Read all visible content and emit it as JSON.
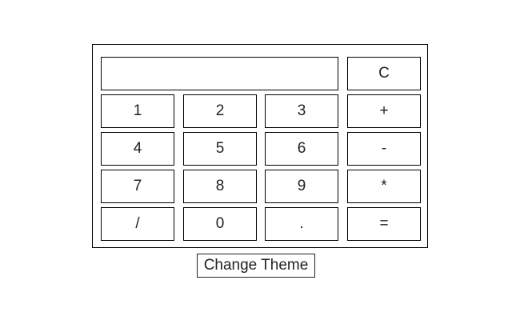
{
  "calculator": {
    "display": {
      "value": ""
    },
    "keys": {
      "clear": "C",
      "one": "1",
      "two": "2",
      "three": "3",
      "plus": "+",
      "four": "4",
      "five": "5",
      "six": "6",
      "minus": "-",
      "seven": "7",
      "eight": "8",
      "nine": "9",
      "multiply": "*",
      "divide": "/",
      "zero": "0",
      "decimal": ".",
      "equals": "="
    }
  },
  "theme_button": {
    "label": "Change Theme"
  }
}
